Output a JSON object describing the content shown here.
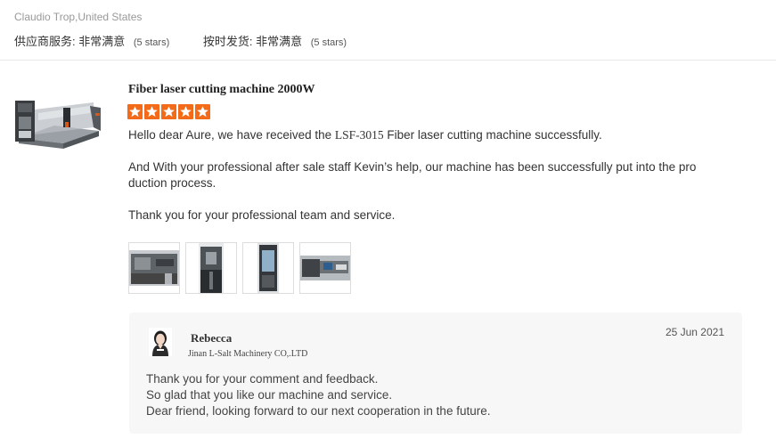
{
  "review": {
    "reviewer": "Claudio Trop,United States",
    "ratings": [
      {
        "label": "供应商服务:",
        "value": "非常满意",
        "stars": "(5 stars)"
      },
      {
        "label": "按时发货:",
        "value": "非常满意",
        "stars": "(5 stars)"
      }
    ],
    "product": {
      "title": "Fiber laser cutting machine 2000W",
      "star_count": 5,
      "thumbnail_icon": "laser-cutting-machine-icon"
    },
    "body": {
      "p1_pre": "Hello dear Aure, we have received the ",
      "p1_model": "LSF-3015",
      "p1_post": " Fiber laser cutting machine successfully.",
      "p2_line1": "And With your professional after sale staff  Kevin’s  help, our machine has been successfully put into the pro",
      "p2_line2": "duction process.",
      "p3": "Thank you for your professional team and service."
    },
    "photos": [
      "machine-photo-1",
      "machine-photo-2",
      "machine-photo-3",
      "machine-photo-4"
    ]
  },
  "reply": {
    "name": "Rebecca",
    "company": "Jinan L-Salt Machinery CO,.LTD",
    "date": "25 Jun 2021",
    "lines": [
      "Thank you for your comment and feedback.",
      "So glad that you like our machine and service.",
      "Dear friend, looking forward to our next cooperation  in the future."
    ]
  },
  "colors": {
    "star": "#f36b18",
    "reply_bg": "#f7f7f7",
    "muted_text": "#999999"
  }
}
